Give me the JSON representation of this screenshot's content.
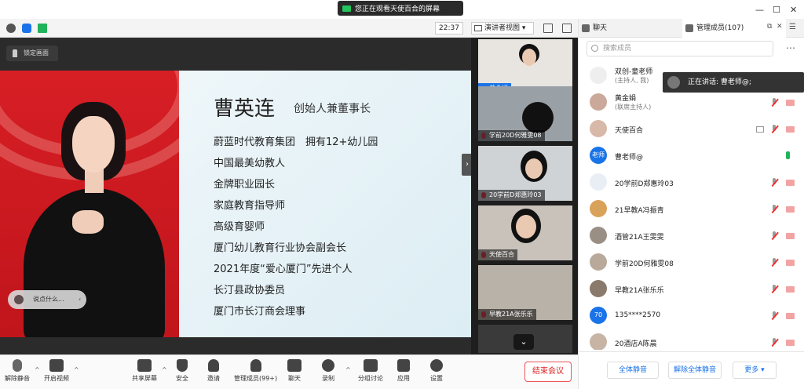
{
  "window": {
    "share_banner": "您正在观看天使百合的屏幕"
  },
  "infobar": {
    "time": "22:37",
    "view_label": "演讲者视图"
  },
  "stage": {
    "lock_label": "锁定画面",
    "slide": {
      "name": "曹英连",
      "title_suffix": "创始人兼董事长",
      "lines": [
        "蔚蓝时代教育集团　拥有12+幼儿园",
        "中国最美幼教人",
        "金牌职业园长",
        "家庭教育指导师",
        "高级育婴师",
        "厦门幼儿教育行业协会副会长",
        "2021年度“爱心厦门”先进个人",
        "长汀县政协委员",
        "厦门市长汀商会理事"
      ]
    },
    "chat_placeholder": "说点什么..."
  },
  "video_tiles": [
    "黄金娟",
    "学前20D何雅雯08",
    "20学前D郑惠玲03",
    "天使百合",
    "早教21A张乐乐"
  ],
  "toolbar": {
    "unmute": "解除静音",
    "start_video": "开启视频",
    "share": "共享屏幕",
    "security": "安全",
    "invite": "邀请",
    "members": "管理成员(99+)",
    "chat": "聊天",
    "record": "录制",
    "breakout": "分组讨论",
    "apps": "应用",
    "settings": "设置",
    "end": "结束会议"
  },
  "right_panel": {
    "tab_chat": "聊天",
    "tab_members": "管理成员(107)",
    "search_placeholder": "搜索成员",
    "speaking": "正在讲话: 曹老师@;",
    "members": [
      {
        "name": "双创-童老师",
        "role": "(主持人, 我)"
      },
      {
        "name": "黄金娟",
        "role": "(联席主持人)"
      },
      {
        "name": "天使百合",
        "role": ""
      },
      {
        "name": "曹老师@",
        "role": "",
        "avatar_text": "老师"
      },
      {
        "name": "20学前D郑惠玲03",
        "role": ""
      },
      {
        "name": "21早教A冯振青",
        "role": ""
      },
      {
        "name": "酒管21A王雯雯",
        "role": ""
      },
      {
        "name": "学前20D何雅雯08",
        "role": ""
      },
      {
        "name": "早教21A张乐乐",
        "role": ""
      },
      {
        "name": "135****2570",
        "role": "",
        "avatar_text": "70"
      },
      {
        "name": "20酒店A陈晨",
        "role": ""
      }
    ],
    "mute_all": "全体静音",
    "unmute_all": "解除全体静音",
    "more": "更多 ▾"
  }
}
